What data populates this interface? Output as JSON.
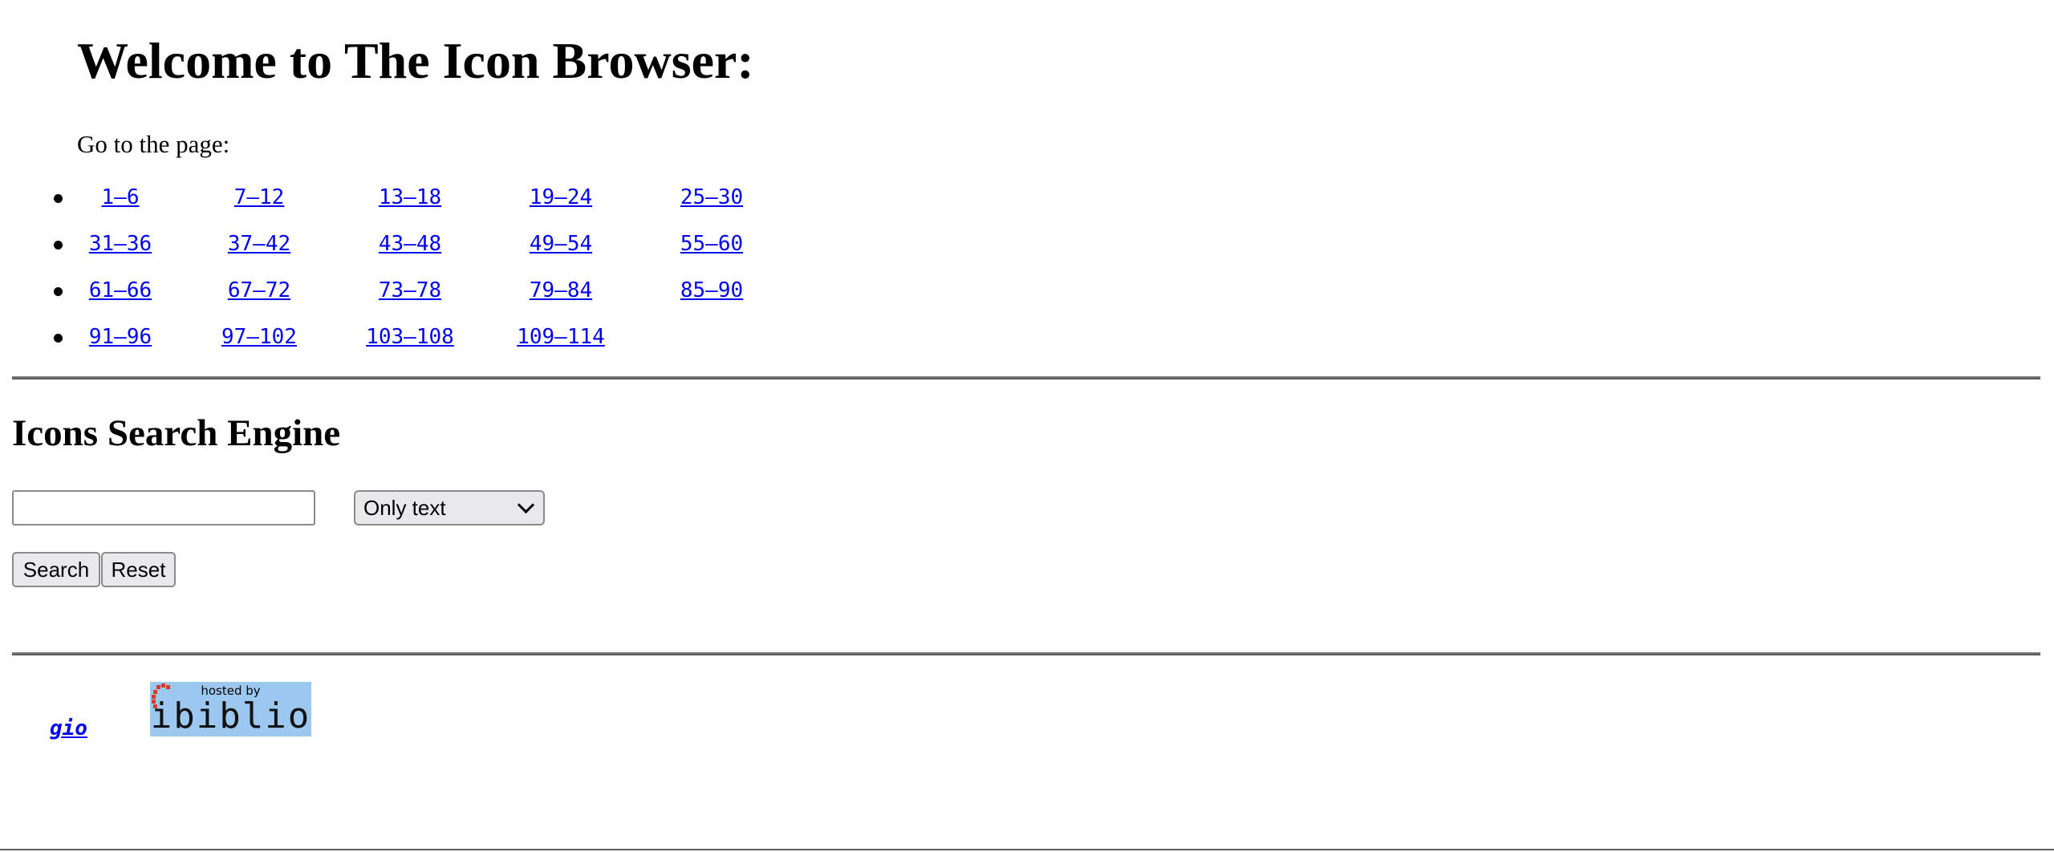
{
  "header": {
    "title": "Welcome to The Icon Browser:",
    "goto_label": "Go to the page:"
  },
  "pages": {
    "rows": [
      [
        "1–6",
        "7–12",
        "13–18",
        "19–24",
        "25–30"
      ],
      [
        "31–36",
        "37–42",
        "43–48",
        "49–54",
        "55–60"
      ],
      [
        "61–66",
        "67–72",
        "73–78",
        "79–84",
        "85–90"
      ],
      [
        "91–96",
        "97–102",
        "103–108",
        "109–114"
      ]
    ]
  },
  "search": {
    "title": "Icons Search Engine",
    "input_value": "",
    "select_value": "Only text",
    "search_label": "Search",
    "reset_label": "Reset"
  },
  "footer": {
    "gio_label": "gio",
    "logo_hosted_by": "hosted by",
    "logo_word": "ibiblio"
  },
  "colors": {
    "link": "#0000ee",
    "logo_bg": "#9cc8f0",
    "logo_accent": "#d83a2e"
  },
  "icons": {
    "dropdown": "chevron-down-icon",
    "logo": "ibiblio-logo"
  }
}
